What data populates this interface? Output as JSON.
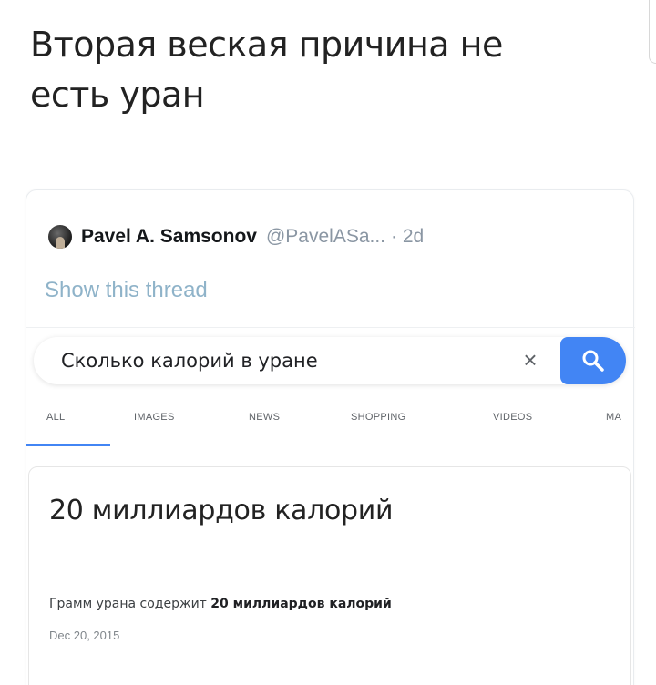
{
  "caption": {
    "line1": "Вторая веская причина не",
    "line2": "есть уран"
  },
  "tweet": {
    "author_name": "Pavel A. Samsonov",
    "author_handle": "@PavelASa...",
    "time": "· 2d",
    "show_thread": "Show this thread"
  },
  "search": {
    "query": "Сколько калорий в уране",
    "clear_icon": "×",
    "tabs": [
      {
        "label": "ALL"
      },
      {
        "label": "IMAGES"
      },
      {
        "label": "NEWS"
      },
      {
        "label": "SHOPPING"
      },
      {
        "label": "VIDEOS"
      },
      {
        "label": "MA"
      }
    ]
  },
  "answer": {
    "title": "20 миллиардов калорий",
    "snippet_prefix": "Грамм урана содержит ",
    "snippet_bold": "20 миллиардов калорий",
    "date": "Dec 20, 2015"
  },
  "colors": {
    "accent": "#4285f4",
    "link": "#8fb3c9",
    "muted": "#8a96a3"
  }
}
